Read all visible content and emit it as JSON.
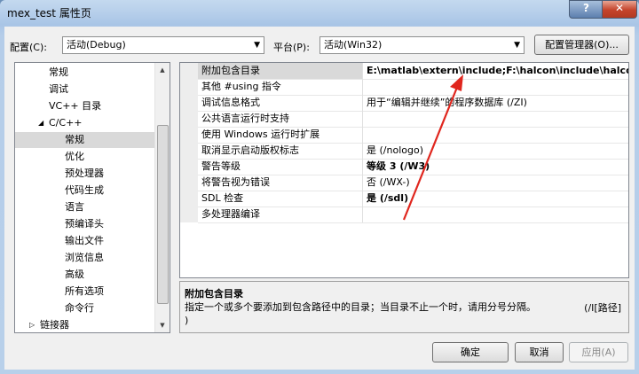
{
  "window": {
    "title": "mex_test 属性页",
    "help": "?",
    "close": "✕"
  },
  "toolbar": {
    "config_label": "配置(C):",
    "config_value": "活动(Debug)",
    "platform_label": "平台(P):",
    "platform_value": "活动(Win32)",
    "config_manager": "配置管理器(O)..."
  },
  "tree": {
    "items": [
      {
        "label": "常规"
      },
      {
        "label": "调试"
      },
      {
        "label": "VC++ 目录"
      },
      {
        "label": "C/C++",
        "toggle": "◢"
      },
      {
        "label": "常规"
      },
      {
        "label": "优化"
      },
      {
        "label": "预处理器"
      },
      {
        "label": "代码生成"
      },
      {
        "label": "语言"
      },
      {
        "label": "预编译头"
      },
      {
        "label": "输出文件"
      },
      {
        "label": "浏览信息"
      },
      {
        "label": "高级"
      },
      {
        "label": "所有选项"
      },
      {
        "label": "命令行"
      },
      {
        "label": "链接器",
        "toggle": "▷"
      }
    ]
  },
  "properties": [
    {
      "name": "附加包含目录",
      "value": "E:\\matlab\\extern\\include;F:\\halcon\\include\\halco"
    },
    {
      "name": "其他 #using 指令",
      "value": ""
    },
    {
      "name": "调试信息格式",
      "value": "用于“编辑并继续”的程序数据库 (/ZI)"
    },
    {
      "name": "公共语言运行时支持",
      "value": ""
    },
    {
      "name": "使用 Windows 运行时扩展",
      "value": ""
    },
    {
      "name": "取消显示启动版权标志",
      "value": "是 (/nologo)"
    },
    {
      "name": "警告等级",
      "value": "等级 3 (/W3)"
    },
    {
      "name": "将警告视为错误",
      "value": "否 (/WX-)"
    },
    {
      "name": "SDL 检查",
      "value": "是 (/sdl)"
    },
    {
      "name": "多处理器编译",
      "value": ""
    }
  ],
  "description": {
    "title": "附加包含目录",
    "text": "指定一个或多个要添加到包含路径中的目录；当目录不止一个时，请用分号分隔。",
    "flag": "(/I[路径]",
    "tail": ")"
  },
  "buttons": {
    "ok": "确定",
    "cancel": "取消",
    "apply": "应用(A)"
  },
  "colors": {
    "arrow": "#e0261e"
  }
}
